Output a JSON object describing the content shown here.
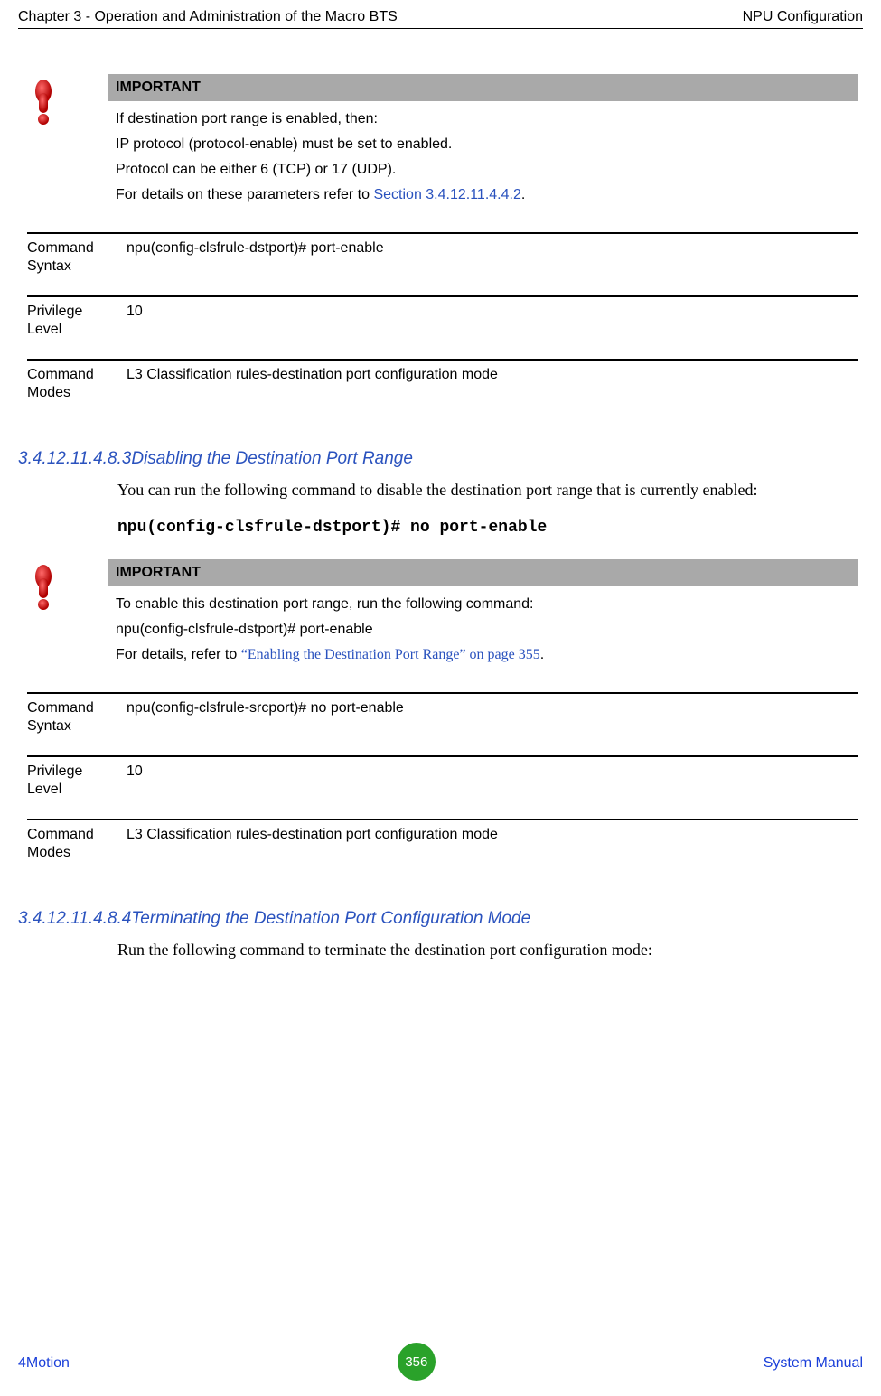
{
  "header": {
    "left": "Chapter 3 - Operation and Administration of the Macro BTS",
    "right": "NPU Configuration"
  },
  "important1": {
    "title": "IMPORTANT",
    "line1": "If destination port range is enabled, then:",
    "line2": "IP protocol (protocol-enable) must be set to enabled.",
    "line3": "Protocol can be either 6 (TCP) or 17 (UDP).",
    "line4_pre": "For details on these parameters refer to ",
    "line4_link": "Section 3.4.12.11.4.4.2",
    "line4_post": "."
  },
  "fields1": {
    "syntax_label": "Command Syntax",
    "syntax_value": "npu(config-clsfrule-dstport)# port-enable",
    "priv_label": "Privilege Level",
    "priv_value": "10",
    "modes_label": "Command Modes",
    "modes_value": "L3 Classification rules-destination port configuration mode"
  },
  "section1": {
    "heading": "3.4.12.11.4.8.3Disabling the Destination Port Range",
    "body": "You can run the following command to disable the destination port range that is currently enabled:",
    "code": "npu(config-clsfrule-dstport)# no port-enable"
  },
  "important2": {
    "title": "IMPORTANT",
    "line1": "To enable this destination port range, run the following command:",
    "line2": "npu(config-clsfrule-dstport)# port-enable",
    "line3_pre": "For details, refer to ",
    "line3_link": "“Enabling the Destination Port Range” on page 355",
    "line3_post": "."
  },
  "fields2": {
    "syntax_label": "Command Syntax",
    "syntax_value": "npu(config-clsfrule-srcport)# no port-enable",
    "priv_label": "Privilege Level",
    "priv_value": "10",
    "modes_label": "Command Modes",
    "modes_value": "L3 Classification rules-destination port configuration mode"
  },
  "section2": {
    "heading": "3.4.12.11.4.8.4Terminating the Destination Port Configuration Mode",
    "body": "Run the following command to terminate the destination port configuration mode:"
  },
  "footer": {
    "left": "4Motion",
    "center": "356",
    "right": "System Manual"
  }
}
